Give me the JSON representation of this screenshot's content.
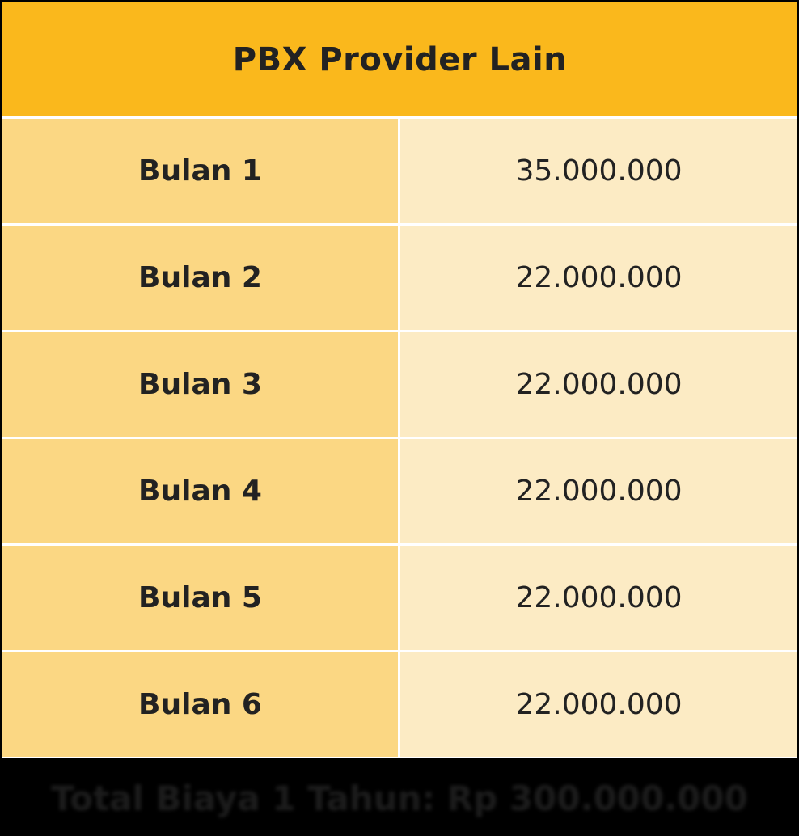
{
  "table": {
    "title": "PBX Provider Lain",
    "rows": [
      {
        "label": "Bulan 1",
        "value": "35.000.000"
      },
      {
        "label": "Bulan 2",
        "value": "22.000.000"
      },
      {
        "label": "Bulan 3",
        "value": "22.000.000"
      },
      {
        "label": "Bulan 4",
        "value": "22.000.000"
      },
      {
        "label": "Bulan 5",
        "value": "22.000.000"
      },
      {
        "label": "Bulan 6",
        "value": "22.000.000"
      }
    ]
  },
  "footer": {
    "total_text": "Total Biaya 1 Tahun: Rp 300.000.000"
  },
  "colors": {
    "header_bg": "#fab81c",
    "label_bg": "#fbd783",
    "value_bg": "#fcebc4",
    "text": "#222222",
    "page_bg": "#000000"
  }
}
